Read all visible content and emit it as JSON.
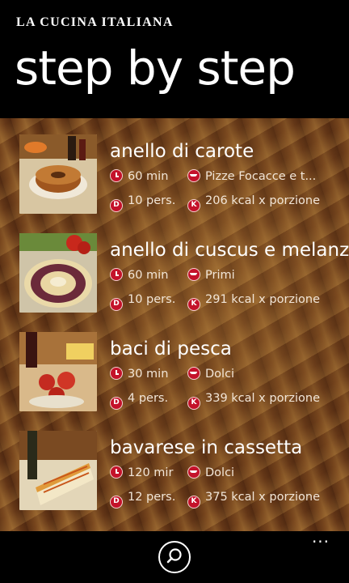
{
  "header": {
    "brand": "LA CUCINA ITALIANA",
    "title": "step by step"
  },
  "recipes": [
    {
      "title": "anello di carote",
      "time": "60 min",
      "category": "Pizze Focacce e t...",
      "servings": "10 pers.",
      "kcal": "206 kcal x porzione"
    },
    {
      "title": "anello di cuscus e melanzane",
      "time": "60 min",
      "category": "Primi",
      "servings": "10 pers.",
      "kcal": "291 kcal x porzione"
    },
    {
      "title": "baci di pesca",
      "time": "30 min",
      "category": "Dolci",
      "servings": "4 pers.",
      "kcal": "339 kcal x porzione"
    },
    {
      "title": "bavarese in cassetta",
      "time": "120 mir",
      "category": "Dolci",
      "servings": "12 pers.",
      "kcal": "375 kcal x porzione"
    }
  ],
  "icons": {
    "time": "clock-icon",
    "category": "dish-icon",
    "servings": "d-icon",
    "kcal": "k-icon",
    "accent": "#c4122a"
  },
  "appbar": {
    "search_icon": "search-icon",
    "more": "..."
  }
}
